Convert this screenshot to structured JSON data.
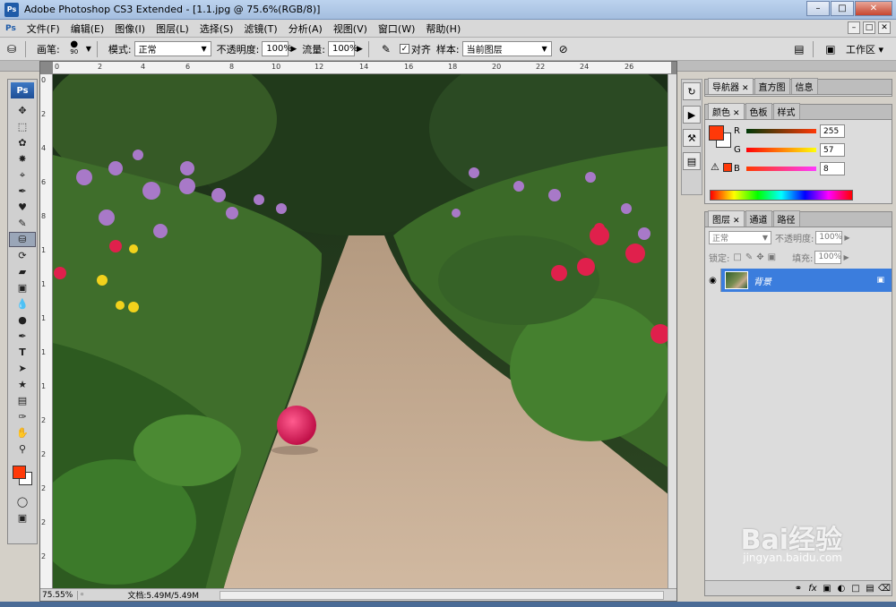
{
  "window": {
    "title": "Adobe Photoshop CS3 Extended - [1.1.jpg @ 75.6%(RGB/8)]",
    "app_icon": "Ps"
  },
  "menu": [
    "文件(F)",
    "编辑(E)",
    "图像(I)",
    "图层(L)",
    "选择(S)",
    "滤镜(T)",
    "分析(A)",
    "视图(V)",
    "窗口(W)",
    "帮助(H)"
  ],
  "options": {
    "brush_label": "画笔:",
    "brush_size": "90",
    "mode_label": "模式:",
    "mode_value": "正常",
    "opacity_label": "不透明度:",
    "opacity_value": "100%",
    "flow_label": "流量:",
    "flow_value": "100%",
    "align_label": "对齐",
    "sample_label": "样本:",
    "sample_value": "当前图层",
    "workspace_label": "工作区 ▾"
  },
  "toolbox": {
    "logo": "Ps"
  },
  "rulers": {
    "h": [
      "0",
      "2",
      "4",
      "6",
      "8",
      "10",
      "12",
      "14",
      "16",
      "18",
      "20",
      "22",
      "24",
      "26"
    ],
    "v": [
      "0",
      "2",
      "4",
      "6",
      "8",
      "1",
      "1",
      "1",
      "1",
      "1",
      "2",
      "2",
      "2",
      "2",
      "2"
    ]
  },
  "status": {
    "zoom": "75.55%",
    "doc_size": "文档:5.49M/5.49M"
  },
  "panels": {
    "navigator_tabs": [
      "导航器",
      "直方图",
      "信息"
    ],
    "color_tabs": [
      "颜色",
      "色板",
      "样式"
    ],
    "color": {
      "r_label": "R",
      "r_value": "255",
      "g_label": "G",
      "g_value": "57",
      "b_label": "B",
      "b_value": "8",
      "fg_color": "#ff3908"
    },
    "layers_tabs": [
      "图层",
      "通道",
      "路径"
    ],
    "layers": {
      "blend_mode": "正常",
      "opacity_label": "不透明度:",
      "opacity_value": "100%",
      "lock_label": "锁定:",
      "fill_label": "填充:",
      "fill_value": "100%",
      "items": [
        {
          "name": "背景"
        }
      ]
    }
  },
  "watermark": {
    "brand": "Bai经验",
    "url": "jingyan.baidu.com"
  }
}
